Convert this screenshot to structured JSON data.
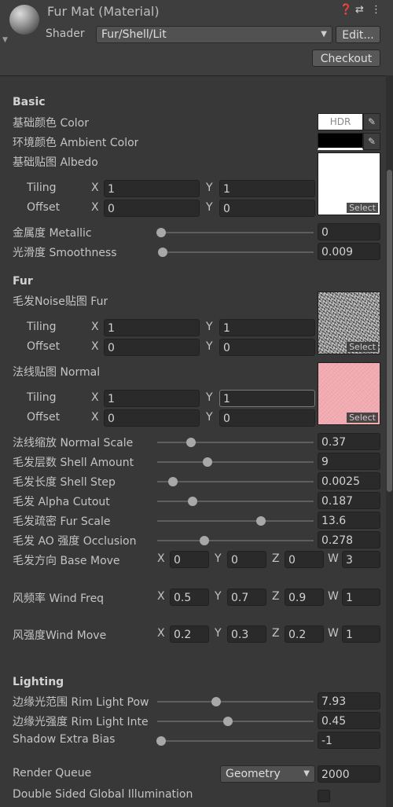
{
  "header": {
    "title": "Fur Mat (Material)",
    "shader_label": "Shader",
    "shader_value": "Fur/Shell/Lit",
    "edit_label": "Edit...",
    "checkout_label": "Checkout"
  },
  "basic": {
    "section": "Basic",
    "color_label": "基础颜色 Color",
    "color_hdr": "HDR",
    "color_value": "#ffffff",
    "ambient_label": "环境颜色 Ambient Color",
    "ambient_value": "#000000",
    "albedo_label": "基础贴图 Albedo",
    "albedo_tiling": {
      "label": "Tiling",
      "x": "1",
      "y": "1"
    },
    "albedo_offset": {
      "label": "Offset",
      "x": "0",
      "y": "0"
    },
    "metallic_label": "金属度 Metallic",
    "metallic_value": "0",
    "metallic_pos": 0,
    "smoothness_label": "光滑度 Smoothness",
    "smoothness_value": "0.009",
    "smoothness_pos": 0.009
  },
  "fur": {
    "section": "Fur",
    "noise_label": "毛发Noise贴图 Fur",
    "noise_tiling": {
      "label": "Tiling",
      "x": "1",
      "y": "1"
    },
    "noise_offset": {
      "label": "Offset",
      "x": "0",
      "y": "0"
    },
    "normal_label": "法线贴图 Normal",
    "normal_tiling": {
      "label": "Tiling",
      "x": "1",
      "y": "1"
    },
    "normal_offset": {
      "label": "Offset",
      "x": "0",
      "y": "0"
    },
    "sliders": [
      {
        "label": "法线缩放 Normal Scale",
        "value": "0.37",
        "pos": 0.2
      },
      {
        "label": "毛发层数 Shell Amount",
        "value": "9",
        "pos": 0.31
      },
      {
        "label": "毛发长度 Shell Step",
        "value": "0.0025",
        "pos": 0.08
      },
      {
        "label": "毛发 Alpha Cutout",
        "value": "0.187",
        "pos": 0.21
      },
      {
        "label": "毛发疏密 Fur Scale",
        "value": "13.6",
        "pos": 0.67
      },
      {
        "label": "毛发 AO 强度 Occlusion",
        "value": "0.278",
        "pos": 0.29
      }
    ],
    "base_move": {
      "label": "毛发方向 Base Move",
      "x": "0",
      "y": "0",
      "z": "0",
      "w": "3"
    },
    "wind_freq": {
      "label": "风频率 Wind Freq",
      "x": "0.5",
      "y": "0.7",
      "z": "0.9",
      "w": "1"
    },
    "wind_move": {
      "label": "风强度Wind Move",
      "x": "0.2",
      "y": "0.3",
      "z": "0.2",
      "w": "1"
    }
  },
  "lighting": {
    "section": "Lighting",
    "sliders": [
      {
        "label": "边缘光范围 Rim Light Pow",
        "value": "7.93",
        "pos": 0.37
      },
      {
        "label": "边缘光强度 Rim Light Inte",
        "value": "0.45",
        "pos": 0.45
      },
      {
        "label": "Shadow Extra Bias",
        "value": "-1",
        "pos": 0
      }
    ]
  },
  "advanced": {
    "render_queue_label": "Render Queue",
    "render_queue_option": "Geometry",
    "render_queue_value": "2000",
    "dsgi_label": "Double Sided Global Illumination",
    "dsgi_checked": false
  },
  "axes": {
    "x": "X",
    "y": "Y",
    "z": "Z",
    "w": "W"
  },
  "textures": {
    "select_label": "Select"
  }
}
